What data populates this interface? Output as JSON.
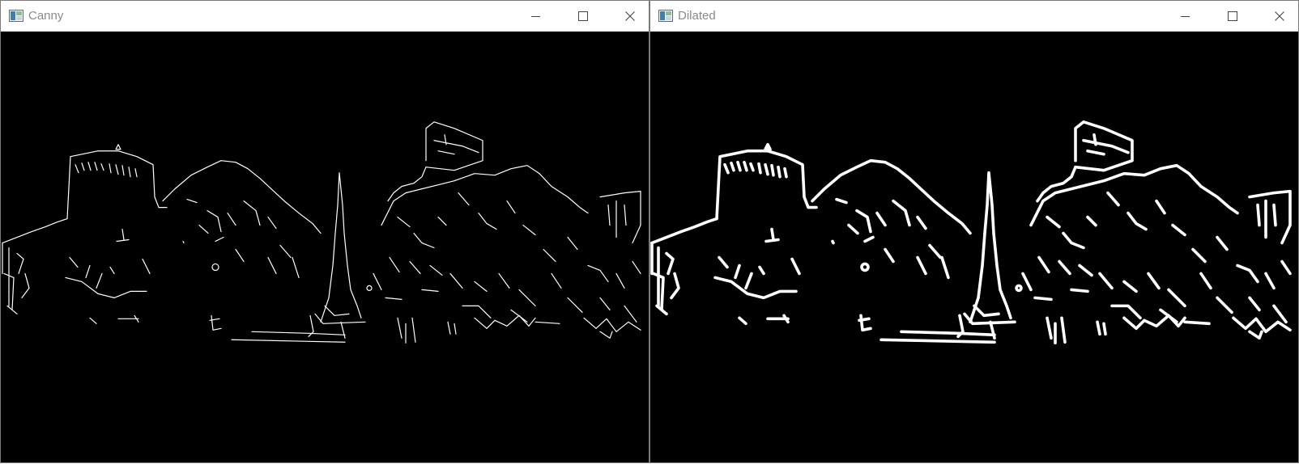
{
  "windows": [
    {
      "title": "Canny",
      "image": "canny-edge-output",
      "stroke_color": "#ffffff",
      "background_color": "#000000"
    },
    {
      "title": "Dilated",
      "image": "dilated-edge-output",
      "stroke_color": "#ffffff",
      "background_color": "#000000"
    }
  ],
  "icons": {
    "app": "opencv-window-icon",
    "minimize": "minimize-icon",
    "maximize": "maximize-icon",
    "close": "close-icon"
  }
}
